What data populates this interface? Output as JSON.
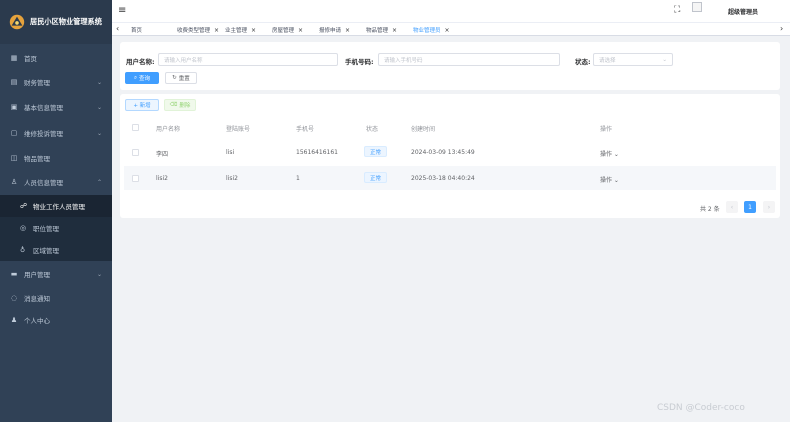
{
  "app": {
    "title": "居民小区物业管理系统"
  },
  "header": {
    "user_name": "超级管理员"
  },
  "tags": [
    {
      "label": "首页"
    },
    {
      "label": "收费类型管理"
    },
    {
      "label": "业主管理"
    },
    {
      "label": "房屋管理"
    },
    {
      "label": "报修申请"
    },
    {
      "label": "物品管理"
    },
    {
      "label": "物业管理员"
    }
  ],
  "sidebar": {
    "items": [
      {
        "label": "首页",
        "icon": "dashboard-icon"
      },
      {
        "label": "财务管理",
        "icon": "finance-icon"
      },
      {
        "label": "基本信息管理",
        "icon": "info-icon"
      },
      {
        "label": "维修投诉管理",
        "icon": "repair-icon"
      },
      {
        "label": "物品管理",
        "icon": "goods-icon"
      },
      {
        "label": "人员信息管理",
        "icon": "people-icon"
      },
      {
        "label": "用户管理",
        "icon": "user-manage-icon"
      },
      {
        "label": "消息通知",
        "icon": "notice-icon"
      },
      {
        "label": "个人中心",
        "icon": "profile-icon"
      }
    ],
    "sub_items": [
      {
        "label": "物业工作人员管理",
        "icon": "staff-icon"
      },
      {
        "label": "职位管理",
        "icon": "position-icon"
      },
      {
        "label": "区域管理",
        "icon": "area-icon"
      }
    ]
  },
  "search": {
    "username_label": "用户名称:",
    "username_placeholder": "请输入用户名称",
    "phone_label": "手机号码:",
    "phone_placeholder": "请输入手机号码",
    "status_label": "状态:",
    "status_placeholder": "请选择",
    "query_label": "查询",
    "reset_label": "重置"
  },
  "toolbar": {
    "add_label": "+ 新增",
    "delete_label": "删除"
  },
  "table": {
    "headers": [
      "用户名称",
      "登陆账号",
      "手机号",
      "状态",
      "创建时间",
      "操作"
    ],
    "rows": [
      {
        "name": "李四",
        "account": "lisi",
        "phone": "15616416161",
        "status": "正常",
        "created": "2024-03-09 13:45:49",
        "action": "操作 ⌄"
      },
      {
        "name": "lisi2",
        "account": "lisi2",
        "phone": "1",
        "status": "正常",
        "created": "2025-03-18 04:40:24",
        "action": "操作 ⌄"
      }
    ]
  },
  "pagination": {
    "total_label": "共 2 条",
    "current_page": "1"
  },
  "watermark": "CSDN @Coder-coco",
  "colors": {
    "sidebar_bg": "#304156",
    "primary": "#409eff"
  }
}
